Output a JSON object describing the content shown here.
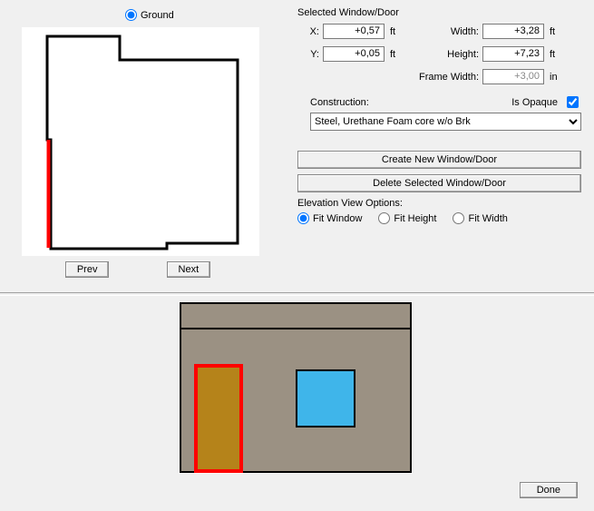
{
  "floor": {
    "name": "Ground",
    "selected": true
  },
  "nav": {
    "prev": "Prev",
    "next": "Next"
  },
  "selected_group_title": "Selected Window/Door",
  "fields": {
    "x_label": "X:",
    "x_value": "+0,57",
    "x_unit": "ft",
    "y_label": "Y:",
    "y_value": "+0,05",
    "y_unit": "ft",
    "width_label": "Width:",
    "width_value": "+3,28",
    "width_unit": "ft",
    "height_label": "Height:",
    "height_value": "+7,23",
    "height_unit": "ft",
    "framewidth_label": "Frame Width:",
    "framewidth_value": "+3,00",
    "framewidth_unit": "in"
  },
  "construction": {
    "label": "Construction:",
    "is_opaque_label": "Is Opaque",
    "is_opaque_checked": true,
    "selected": "Steel, Urethane Foam core w/o Brk"
  },
  "actions": {
    "create": "Create New Window/Door",
    "delete": "Delete Selected Window/Door"
  },
  "elev_options": {
    "title": "Elevation View Options:",
    "fit_window": "Fit Window",
    "fit_height": "Fit Height",
    "fit_width": "Fit Width",
    "selected": "fit_window"
  },
  "done": "Done",
  "colors": {
    "highlight": "#ff0000",
    "wall": "#9b9183",
    "door_fill": "#b5831a",
    "window_fill": "#3fb5ea"
  }
}
